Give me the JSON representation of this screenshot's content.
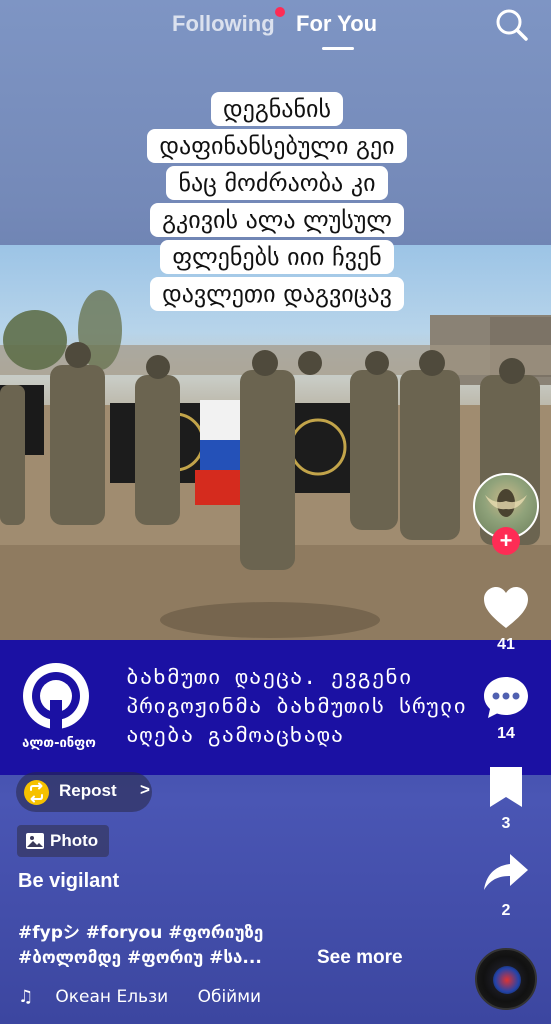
{
  "top_nav": {
    "following_label": "Following",
    "for_you_label": "For You",
    "active_tab": "For You"
  },
  "caption": {
    "lines": [
      "დეგნანის",
      "დაფინანსებული გეი",
      "ნაც მოძრაობა კი",
      "გკივის  ალა ლუსულ",
      "ფლენებს იიი ჩვენ",
      "დავლეთი დაგვიცავ"
    ]
  },
  "banner": {
    "logo_text": "ალთ-ინფო",
    "lines": [
      "ბახმუთი დაეცა. ევგენი",
      "პრიგოჟინმა ბახმუთის სრული",
      "აღება გამოაცხადა"
    ]
  },
  "actions": {
    "likes": "41",
    "comments": "14",
    "saves": "3",
    "shares": "2"
  },
  "post": {
    "repost_label": "Repost",
    "repost_chevron": ">",
    "photo_label": "Photo",
    "title": "Be vigilant",
    "tags_line1": "#fypシ #foryou #ფორიუზე",
    "tags_line2": "#ბოლომდე #ფორიუ #სა...",
    "see_more": "See more",
    "music_artist": "Океан Ельзи",
    "music_title": "Обійми"
  },
  "colors": {
    "accent_red": "#fe2c55",
    "banner_blue": "#1b11a3",
    "repost_yellow": "#f6c100"
  },
  "icons": {
    "search": "search-icon",
    "heart": "heart-icon",
    "comment": "comment-icon",
    "bookmark": "bookmark-icon",
    "share": "share-icon",
    "repost": "repost-icon",
    "photo": "photo-icon",
    "music": "music-note-icon"
  }
}
